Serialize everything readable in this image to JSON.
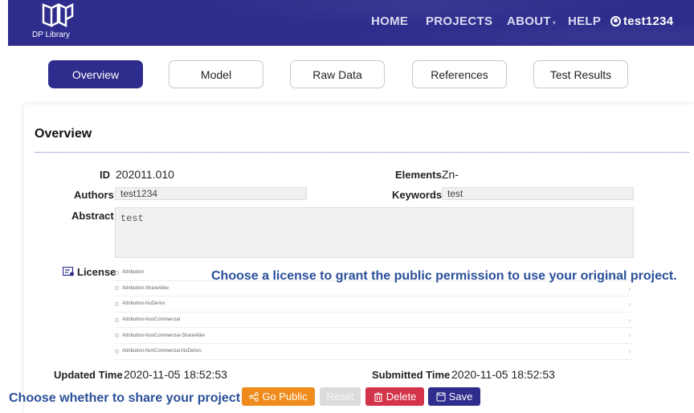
{
  "header": {
    "logo_text": "DP Library",
    "nav": {
      "home": "HOME",
      "projects": "PROJECTS",
      "about": "ABOUT",
      "help": "HELP",
      "user": "test1234"
    }
  },
  "tabs": [
    {
      "label": "Overview",
      "active": true
    },
    {
      "label": "Model",
      "active": false
    },
    {
      "label": "Raw Data",
      "active": false
    },
    {
      "label": "References",
      "active": false
    },
    {
      "label": "Test Results",
      "active": false
    }
  ],
  "overview": {
    "title": "Overview",
    "id_label": "ID",
    "id_value": "202011.010",
    "elements_label": "Elements",
    "elements_value": "Zn-",
    "authors_label": "Authors",
    "authors_value": "test1234",
    "keywords_label": "Keywords",
    "keywords_value": "test",
    "abstract_label": "Abstract",
    "abstract_value": "test",
    "license_label": "License",
    "license_options": [
      "Attribution",
      "Attribution-ShareAlike",
      "Attribution-NoDerivs",
      "Attribution-NonCommercial",
      "Attribution-NonCommercial-ShareAlike",
      "Attribution-NonCommercial-NoDerivs"
    ],
    "updated_label": "Updated Time",
    "updated_value": "2020-11-05 18:52:53",
    "submitted_label": "Submitted Time",
    "submitted_value": "2020-11-05 18:52:53"
  },
  "hints": {
    "license": "Choose a license to grant the public permission to use your original project.",
    "share": "Choose whether to share your project"
  },
  "actions": {
    "go_public": "Go Public",
    "reset": "Reset",
    "delete": "Delete",
    "save": "Save"
  },
  "colors": {
    "primary": "#2e2c8c",
    "public": "#ef8b1c",
    "delete": "#d4344a",
    "hint": "#2a4f9a"
  },
  "icons": {
    "user": "user-circle-icon",
    "license": "certificate-icon",
    "share": "share-icon",
    "delete": "trash-icon",
    "save": "floppy-icon"
  }
}
